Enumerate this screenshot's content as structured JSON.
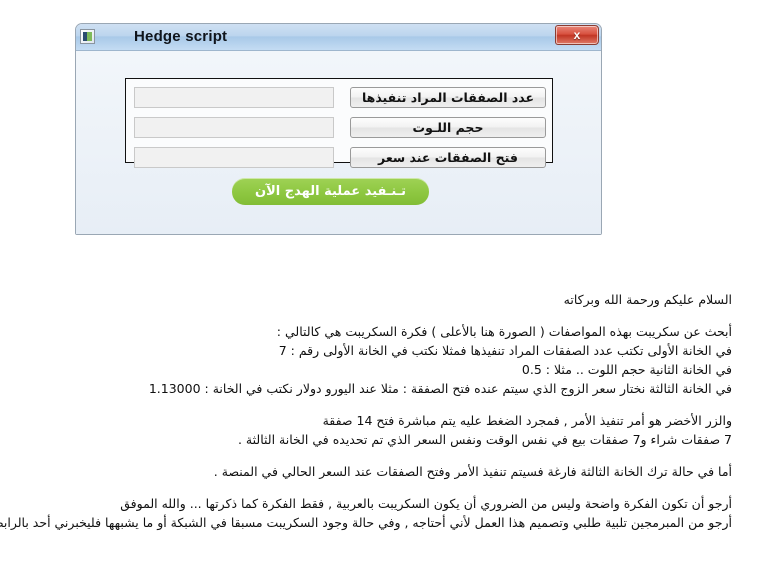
{
  "window": {
    "title": "Hedge script",
    "icon": "application-icon",
    "close_label": "x",
    "fields": [
      {
        "name": "deals-count-field",
        "value": "",
        "placeholder": ""
      },
      {
        "name": "lot-size-field",
        "value": "",
        "placeholder": ""
      },
      {
        "name": "open-price-field",
        "value": "",
        "placeholder": ""
      }
    ],
    "buttons": [
      {
        "name": "deals-count-button",
        "label": "عدد الصفقات المراد تنفيذها"
      },
      {
        "name": "lot-size-button",
        "label": "حجم اللـوت"
      },
      {
        "name": "open-price-button",
        "label": "فتح الصفقات عند سعر"
      }
    ],
    "execute_button": "تـنـفيد عملية الهدج الآن"
  },
  "article": {
    "greeting": "السلام عليكم ورحمة الله وبركاته",
    "block1": [
      "أبحث عن سكريبت بهذه المواصفات ( الصورة هنا بالأعلى ) فكرة السكريبت هي كالتالي :",
      "في الخانة الأولى تكتب عدد الصفقات المراد تنفيذها  فمثلا نكتب في الخانة الأولى رقم : 7",
      "في الخانة الثانية حجم اللوت .. مثلا : 0.5",
      "في الخانة الثالثة نختار سعر الزوج الذي سيتم عنده فتح الصفقة : مثلا عند اليورو دولار نكتب في الخانة : 1.13000"
    ],
    "block2": [
      "والزر الأخضر هو أمر تنفيذ الأمر , فمجرد الضغط عليه يتم مباشرة فتح 14 صفقة",
      "7 صفقات شراء و7 صفقات بيع في نفس الوقت ونفس السعر الذي تم تحديده في الخانة الثالثة ."
    ],
    "block3": [
      "أما في حالة ترك الخانة الثالثة فارغة فسيتم تنفيذ الأمر وفتح الصفقات عند السعر الحالي في المنصة ."
    ],
    "block4": [
      "أرجو أن تكون الفكرة واضحة وليس من الضروري أن يكون السكريبت بالعربية , فقط الفكرة كما ذكرتها ... والله الموفق",
      "أرجو من المبرمجين تلبية طلبي وتصميم هذا العمل لأني أحتاجه , وفي حالة وجود السكريبت مسبقا في الشبكة أو ما يشبهها فليخبرني أحد بالرابط"
    ]
  },
  "colors": {
    "accent_green": "#8cc63f",
    "close_red": "#c13524",
    "title_blue": "#bcd5ee"
  }
}
